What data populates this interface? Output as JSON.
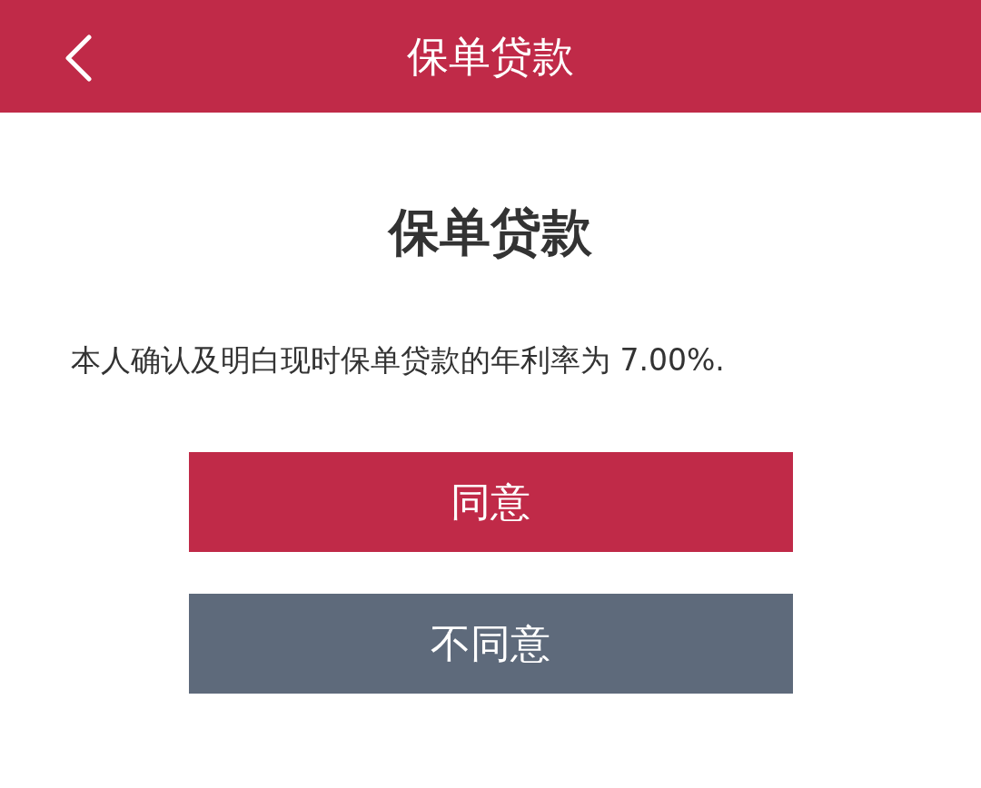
{
  "header": {
    "title": "保单贷款"
  },
  "heading": "保单贷款",
  "statement": "本人确认及明白现时保单贷款的年利率为 7.00%.",
  "buttons": [
    {
      "label": "同意",
      "kind": "primary"
    },
    {
      "label": "不同意",
      "kind": "secondary"
    }
  ]
}
